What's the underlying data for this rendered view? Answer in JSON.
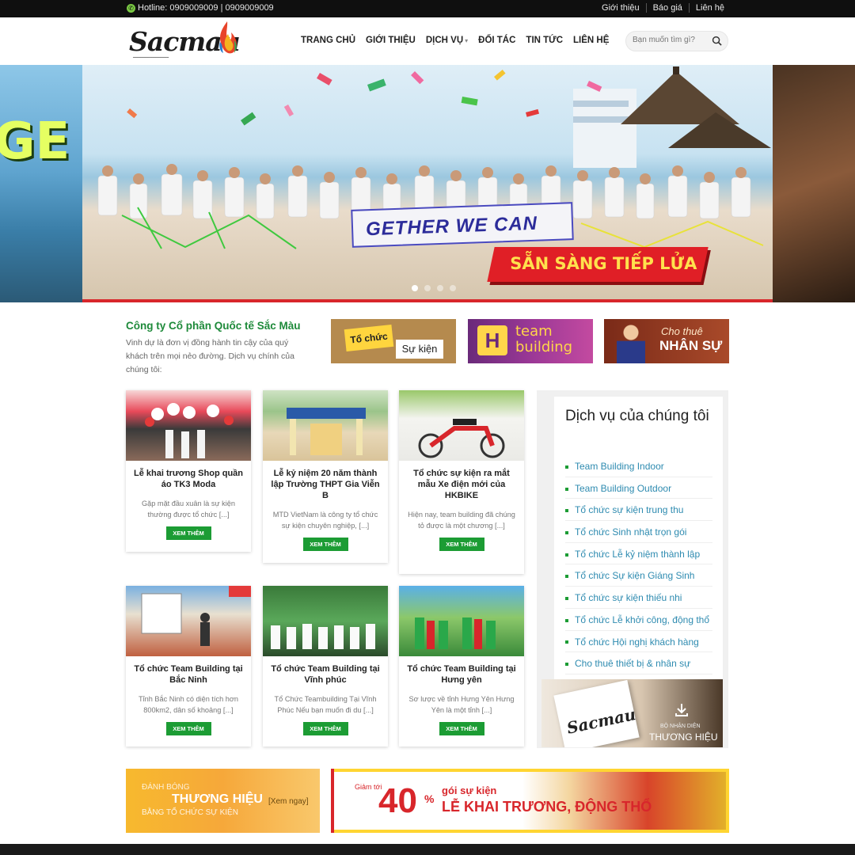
{
  "topbar": {
    "hotline": "Hotline: 0909009009 | 0909009009",
    "links": [
      "Giới thiệu",
      "Báo giá",
      "Liên hệ"
    ]
  },
  "logo": {
    "text": "Sacmau"
  },
  "nav": {
    "items": [
      "TRANG CHỦ",
      "GIỚI THIỆU",
      "DỊCH VỤ",
      "ĐỐI TÁC",
      "TIN TỨC",
      "LIÊN HỆ"
    ]
  },
  "search": {
    "placeholder": "Bạn muốn tìm gì?"
  },
  "hero": {
    "banner_text": "GETHER WE CAN",
    "ribbon_text": "SẴN SÀNG TIẾP LỬA",
    "slide_count": 4,
    "active_slide": 1
  },
  "intro": {
    "heading": "Công ty Cổ phần Quốc tế Sắc Màu",
    "text": "Vinh dự là đơn vị đồng hành tin cậy của quý khách trên mọi nẻo đường. Dịch vụ chính của chúng tôi:"
  },
  "service_tiles": [
    {
      "line1": "Tổ chức",
      "line2": "Sự kiện"
    },
    {
      "line1": "team",
      "line2": "building"
    },
    {
      "line1": "Cho thuê",
      "line2": "NHÂN SỰ"
    }
  ],
  "cards": [
    {
      "title": "Lễ khai trương Shop quần áo TK3 Moda",
      "excerpt": "Gặp mặt đầu xuân là sự kiện thường được tổ chức [...]",
      "button": "XEM THÊM"
    },
    {
      "title": "Lễ kỷ niệm 20 năm thành lập Trường THPT Gia Viễn B",
      "excerpt": "MTD VietNam là công ty tổ chức sự kiện chuyên nghiệp, [...]",
      "button": "XEM THÊM"
    },
    {
      "title": "Tổ chức sự kiện ra mắt mẫu Xe điện mới của HKBIKE",
      "excerpt": "Hiện nay, team building đã chúng tỏ được là một chương [...]",
      "button": "XEM THÊM"
    },
    {
      "title": "Tổ chức Team Building tại Bắc Ninh",
      "excerpt": "Tỉnh Bắc Ninh có diện tích hơn 800km2, dân số khoảng [...]",
      "button": "XEM THÊM"
    },
    {
      "title": "Tổ chức Team Building tại Vĩnh phúc",
      "excerpt": "Tổ Chức Teambuilding Tại Vĩnh Phúc Nếu bạn muốn đi du [...]",
      "button": "XEM THÊM"
    },
    {
      "title": "Tổ chức Team Building tại Hưng yên",
      "excerpt": "Sơ lược về tỉnh Hưng Yên Hưng Yên là một tỉnh [...]",
      "button": "XEM THÊM"
    }
  ],
  "sidebar": {
    "heading": "Dịch vụ của chúng tôi",
    "items": [
      "Team Building Indoor",
      "Team Building Outdoor",
      "Tổ chức sự kiện trung thu",
      "Tổ chức Sinh nhật trọn gói",
      "Tổ chức Lễ kỷ niệm thành lập",
      "Tổ chức Sự kiện Giáng Sinh",
      "Tổ chức sự kiện thiếu nhi",
      "Tổ chức Lễ khởi công, động thổ",
      "Tổ chức Hội nghị khách hàng",
      "Cho thuê thiết bị & nhân sự"
    ],
    "brand_box": {
      "logo": "Sacmau",
      "line1": "BỘ NHẬN DIỆN",
      "line2": "THƯƠNG HIỆU"
    }
  },
  "bottom_banners": {
    "left": {
      "line1": "ĐÁNH BÓNG",
      "line2": "THƯƠNG HIỆU",
      "line3": "BẰNG TỔ CHỨC SỰ KIỆN",
      "cta": "[Xem ngay]"
    },
    "right": {
      "prefix": "Giảm tới",
      "percent": "40",
      "percent_sign": "%",
      "line1": "gói sự kiện",
      "line2": "LỄ KHAI TRƯƠNG, ĐỘNG THỔ"
    }
  },
  "colors": {
    "accent_green": "#1c9c34",
    "link_blue": "#2e8bb0",
    "brand_red": "#d8262b",
    "topbar": "#0f0f0f"
  }
}
